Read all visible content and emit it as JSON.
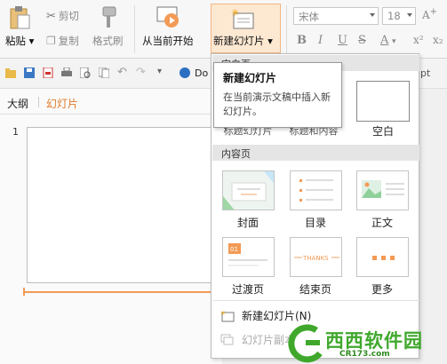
{
  "ribbon": {
    "paste_label": "粘贴",
    "cut_label": "剪切",
    "copy_label": "复制",
    "format_painter_label": "格式刷",
    "from_current_label": "从当前开始",
    "new_slide_label": "新建幻灯片",
    "font_name": "宋体",
    "font_size": "18",
    "accent_color": "#f39a55"
  },
  "quick_access": {
    "doc_label": "Do",
    "right_fragment": "pt"
  },
  "left_panel": {
    "tabs": [
      "大纲",
      "幻灯片"
    ],
    "active_tab": "幻灯片",
    "slide_number": "1"
  },
  "tooltip": {
    "title": "新建幻灯片",
    "description": "在当前演示文稿中插入新幻灯片。"
  },
  "dropdown": {
    "section_blank": "空白页",
    "blank_partial_labels": [
      "标题幻灯片",
      "标题和内容"
    ],
    "blank_label": "空白",
    "section_content": "内容页",
    "layouts": [
      {
        "label": "封面",
        "icon": "cover-layout-icon"
      },
      {
        "label": "目录",
        "icon": "toc-layout-icon"
      },
      {
        "label": "正文",
        "icon": "body-layout-icon"
      },
      {
        "label": "过渡页",
        "icon": "transition-layout-icon"
      },
      {
        "label": "结束页",
        "icon": "ending-layout-icon"
      },
      {
        "label": "更多",
        "icon": "more-layout-icon"
      }
    ],
    "thanks_text": "THANKS",
    "transition_number": "01",
    "new_slide_item": "新建幻灯片(N)",
    "slide_copy_item": "幻灯片副本"
  },
  "watermark": {
    "brand": "西西软件园",
    "url": "CR173.com"
  }
}
